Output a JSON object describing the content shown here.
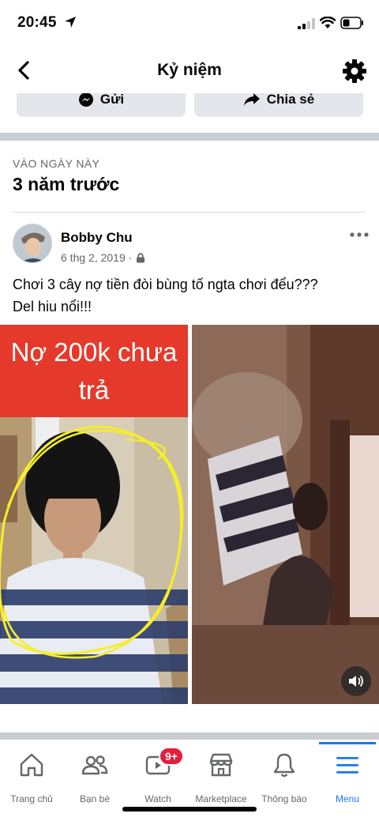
{
  "status_bar": {
    "time": "20:45"
  },
  "header": {
    "title": "Kỷ niệm"
  },
  "actions": {
    "send_label": "Gửi",
    "share_label": "Chia sẻ"
  },
  "memory": {
    "label": "VÀO NGÀY NÀY",
    "years_ago": "3 năm trước"
  },
  "post": {
    "author": "Bobby Chu",
    "date": "6 thg 2, 2019 ·",
    "text_line1": "Chơi 3 cây nợ tiền đòi bùng tố ngta chơi đểu???",
    "text_line2": "Del hiu nổi!!!",
    "photo_caption_line1": "Nợ 200k chưa",
    "photo_caption_line2": "trả"
  },
  "tabs": [
    {
      "label": "Trang chủ",
      "icon": "home-icon"
    },
    {
      "label": "Bạn bè",
      "icon": "friends-icon"
    },
    {
      "label": "Watch",
      "icon": "watch-icon",
      "badge": "9+"
    },
    {
      "label": "Marketplace",
      "icon": "marketplace-icon"
    },
    {
      "label": "Thông báo",
      "icon": "bell-icon"
    },
    {
      "label": "Menu",
      "icon": "menu-icon",
      "active": true
    }
  ],
  "colors": {
    "accent": "#1877f2",
    "badge": "#e41e3f",
    "banner": "#e53a2b",
    "divider": "#c9ccd1"
  }
}
